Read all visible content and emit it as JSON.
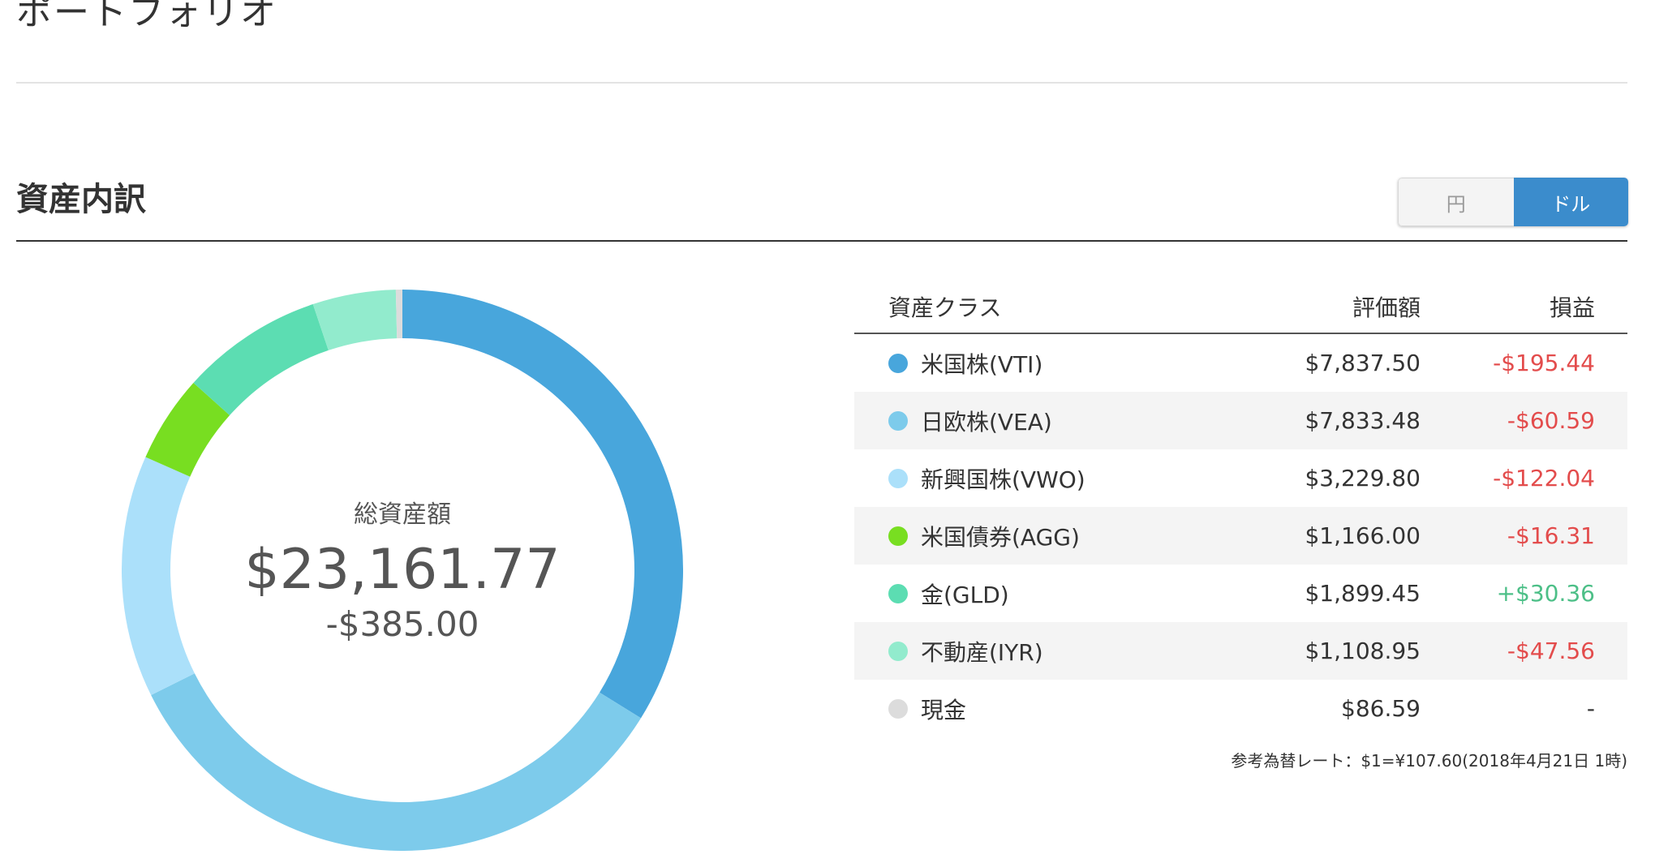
{
  "page_title": "ポートフォリオ",
  "section_title": "資産内訳",
  "currency_toggle": {
    "yen_label": "円",
    "usd_label": "ドル",
    "active": "usd"
  },
  "summary": {
    "label": "総資産額",
    "total": "$23,161.77",
    "change": "-$385.00"
  },
  "table": {
    "headers": {
      "asset_class": "資産クラス",
      "value": "評価額",
      "profit_loss": "損益"
    },
    "rows": [
      {
        "name": "米国株(VTI)",
        "value": "$7,837.50",
        "pl": "-$195.44",
        "amount": 7837.5,
        "color": "#48a6dc",
        "sign": "neg"
      },
      {
        "name": "日欧株(VEA)",
        "value": "$7,833.48",
        "pl": "-$60.59",
        "amount": 7833.48,
        "color": "#7dcbeb",
        "sign": "neg"
      },
      {
        "name": "新興国株(VWO)",
        "value": "$3,229.80",
        "pl": "-$122.04",
        "amount": 3229.8,
        "color": "#abe0fa",
        "sign": "neg"
      },
      {
        "name": "米国債券(AGG)",
        "value": "$1,166.00",
        "pl": "-$16.31",
        "amount": 1166.0,
        "color": "#78de21",
        "sign": "neg"
      },
      {
        "name": "金(GLD)",
        "value": "$1,899.45",
        "pl": "+$30.36",
        "amount": 1899.45,
        "color": "#5cddb2",
        "sign": "pos"
      },
      {
        "name": "不動産(IYR)",
        "value": "$1,108.95",
        "pl": "-$47.56",
        "amount": 1108.95,
        "color": "#92ebcd",
        "sign": "neg"
      },
      {
        "name": "現金",
        "value": "$86.59",
        "pl": "-",
        "amount": 86.59,
        "color": "#dcdcdc",
        "sign": "none"
      }
    ]
  },
  "exchange_note": "参考為替レート：$1=¥107.60(2018年4月21日 1時)"
}
